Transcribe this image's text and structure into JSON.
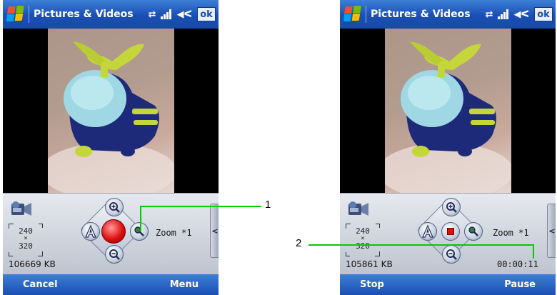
{
  "colors": {
    "titlebar": "#1a4fb3",
    "record": "#e01010",
    "callout": "#00cc00"
  },
  "left_screen": {
    "title": "Pictures & Videos",
    "ok_label": "ok",
    "resolution_w": "240",
    "resolution_x": "×",
    "resolution_h": "320",
    "storage": "106669 KB",
    "zoom": "Zoom *1",
    "side_arrow": "<",
    "soft_left": "Cancel",
    "soft_right": "Menu",
    "center_button": "record-button"
  },
  "right_screen": {
    "title": "Pictures & Videos",
    "ok_label": "ok",
    "resolution_w": "240",
    "resolution_x": "×",
    "resolution_h": "320",
    "storage": "105861 KB",
    "zoom": "Zoom *1",
    "timer": "00:00:11",
    "side_arrow": "<",
    "soft_left": "Stop",
    "soft_right": "Pause",
    "center_button": "stop-button"
  },
  "callouts": {
    "one": "1",
    "two": "2"
  }
}
